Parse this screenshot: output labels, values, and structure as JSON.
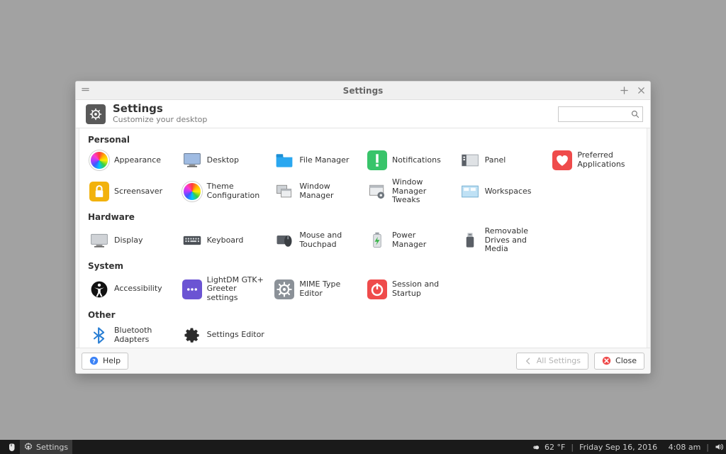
{
  "window": {
    "title": "Settings"
  },
  "header": {
    "title": "Settings",
    "subtitle": "Customize your desktop",
    "search_placeholder": ""
  },
  "categories": [
    {
      "name": "Personal",
      "items": [
        {
          "id": "appearance",
          "label": "Appearance"
        },
        {
          "id": "desktop",
          "label": "Desktop"
        },
        {
          "id": "file-manager",
          "label": "File Manager"
        },
        {
          "id": "notifications",
          "label": "Notifications"
        },
        {
          "id": "panel",
          "label": "Panel"
        },
        {
          "id": "preferred-applications",
          "label": "Preferred Applications"
        },
        {
          "id": "screensaver",
          "label": "Screensaver"
        },
        {
          "id": "theme-configuration",
          "label": "Theme Configuration"
        },
        {
          "id": "window-manager",
          "label": "Window Manager"
        },
        {
          "id": "window-manager-tweaks",
          "label": "Window Manager Tweaks"
        },
        {
          "id": "workspaces",
          "label": "Workspaces"
        }
      ]
    },
    {
      "name": "Hardware",
      "items": [
        {
          "id": "display",
          "label": "Display"
        },
        {
          "id": "keyboard",
          "label": "Keyboard"
        },
        {
          "id": "mouse-touchpad",
          "label": "Mouse and Touchpad"
        },
        {
          "id": "power-manager",
          "label": "Power Manager"
        },
        {
          "id": "removable-drives",
          "label": "Removable Drives and Media"
        }
      ]
    },
    {
      "name": "System",
      "items": [
        {
          "id": "accessibility",
          "label": "Accessibility"
        },
        {
          "id": "lightdm-greeter",
          "label": "LightDM GTK+ Greeter settings"
        },
        {
          "id": "mime-editor",
          "label": "MIME Type Editor"
        },
        {
          "id": "session-startup",
          "label": "Session and Startup"
        }
      ]
    },
    {
      "name": "Other",
      "items": [
        {
          "id": "bluetooth",
          "label": "Bluetooth Adapters"
        },
        {
          "id": "settings-editor",
          "label": "Settings Editor"
        }
      ]
    }
  ],
  "footer": {
    "help": "Help",
    "all_settings": "All Settings",
    "close": "Close"
  },
  "taskbar": {
    "app": "Settings",
    "weather": "62 °F",
    "date": "Friday Sep 16, 2016",
    "time": "4:08 am"
  }
}
